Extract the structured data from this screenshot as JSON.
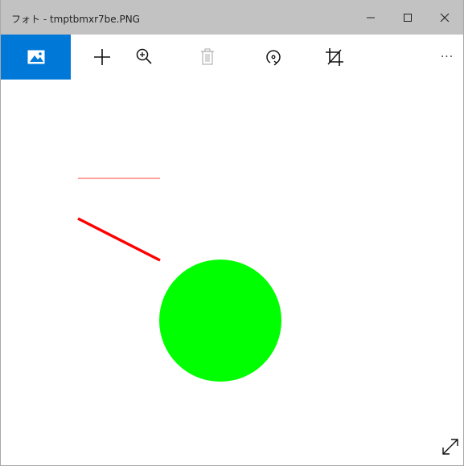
{
  "window": {
    "title": "フォト - tmptbmxr7be.PNG",
    "controls": {
      "minimize_icon": "minimize-icon",
      "maximize_icon": "maximize-icon",
      "close_icon": "close-icon"
    }
  },
  "toolbar": {
    "items": [
      {
        "name": "photos-button",
        "icon": "picture-icon",
        "active": true
      },
      {
        "name": "add-button",
        "icon": "plus-icon"
      },
      {
        "name": "zoom-button",
        "icon": "zoom-in-icon"
      },
      {
        "name": "delete-button",
        "icon": "trash-icon",
        "disabled": true
      },
      {
        "name": "rotate-button",
        "icon": "rotate-icon"
      },
      {
        "name": "crop-button",
        "icon": "crop-icon"
      },
      {
        "name": "more-button",
        "icon": "more-icon",
        "label": "···"
      }
    ]
  },
  "image": {
    "shapes": [
      {
        "type": "line",
        "color": "#ff8080"
      },
      {
        "type": "line",
        "color": "#ff0000"
      },
      {
        "type": "circle",
        "color": "#00ff00"
      }
    ]
  },
  "viewer": {
    "expand_icon": "expand-icon"
  },
  "colors": {
    "titlebar": "#c2c2c2",
    "accent": "#0078d7"
  }
}
